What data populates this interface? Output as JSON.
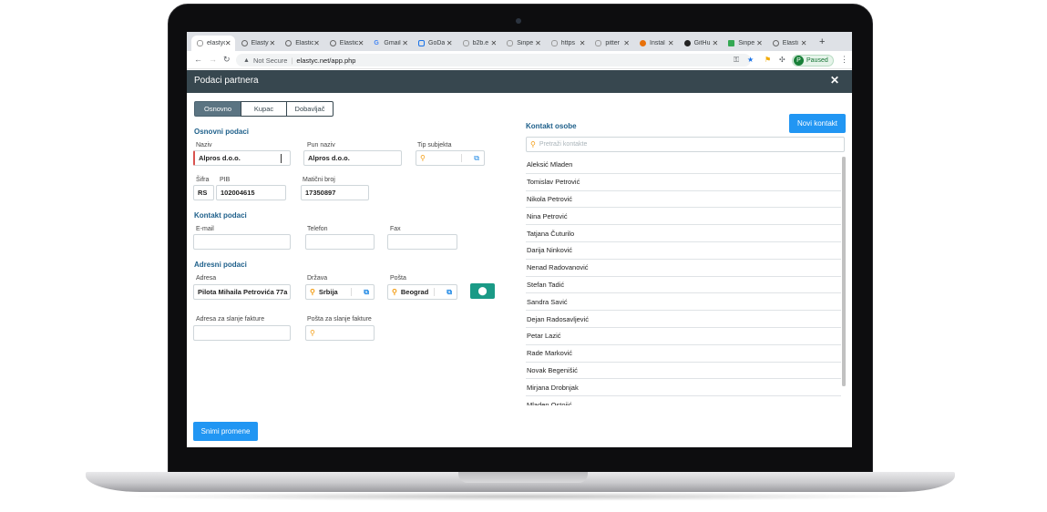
{
  "browser": {
    "tabs": [
      {
        "label": "elastyc",
        "fav": "cloud",
        "active": true
      },
      {
        "label": "Elasty",
        "fav": "globe"
      },
      {
        "label": "Elastic",
        "fav": "globe"
      },
      {
        "label": "Elastic",
        "fav": "globe"
      },
      {
        "label": "Gmail",
        "fav": "g"
      },
      {
        "label": "GoDa",
        "fav": "shield"
      },
      {
        "label": "b2b.e",
        "fav": "cloud"
      },
      {
        "label": "Sinpe",
        "fav": "cloud"
      },
      {
        "label": "https",
        "fav": "cloud"
      },
      {
        "label": "pitter",
        "fav": "cloud"
      },
      {
        "label": "Instal",
        "fav": "fire"
      },
      {
        "label": "GitHu",
        "fav": "gh"
      },
      {
        "label": "Sinpe",
        "fav": "green"
      },
      {
        "label": "Elasti",
        "fav": "globe"
      }
    ],
    "tab_close": "✕",
    "new_tab": "+",
    "security_label": "Not Secure",
    "url": "elastyc.net/app.php",
    "profile_initial": "P",
    "profile_status": "Paused"
  },
  "app": {
    "title": "Podaci partnera",
    "close_icon": "✕",
    "tabs": [
      "Osnovno",
      "Kupac",
      "Dobavljač"
    ],
    "sections": {
      "basic": "Osnovni podaci",
      "contact": "Kontakt podaci",
      "address": "Adresni podaci"
    },
    "fields": {
      "naziv": {
        "label": "Naziv",
        "value": "Alpros d.o.o."
      },
      "pun_naziv": {
        "label": "Pun naziv",
        "value": "Alpros d.o.o."
      },
      "tip_subjekta": {
        "label": "Tip subjekta",
        "value": ""
      },
      "sifra": {
        "label": "Šifra",
        "value": "RS"
      },
      "pib": {
        "label": "PIB",
        "value": "102004615"
      },
      "maticni_broj": {
        "label": "Matični broj",
        "value": "17350897"
      },
      "email": {
        "label": "E-mail",
        "value": ""
      },
      "telefon": {
        "label": "Telefon",
        "value": ""
      },
      "fax": {
        "label": "Fax",
        "value": ""
      },
      "adresa": {
        "label": "Adresa",
        "value": "Pilota Mihaila Petrovića 77a"
      },
      "drzava": {
        "label": "Država",
        "value": "Srbija"
      },
      "posta": {
        "label": "Pošta",
        "value": "Beograd"
      },
      "adresa_fakture": {
        "label": "Adresa za slanje fakture",
        "value": ""
      },
      "posta_fakture": {
        "label": "Pošta za slanje fakture",
        "value": ""
      }
    },
    "save_button": "Snimi promene",
    "contacts": {
      "title": "Kontakt osobe",
      "new_button": "Novi kontakt",
      "search_placeholder": "Pretraži kontakte",
      "items": [
        "Aleksić Mladen",
        "Tomislav Petrović",
        "Nikola Petrović",
        "Nina Petrović",
        "Tatjana Čuturilo",
        "Darija Ninković",
        "Nenad Radovanović",
        "Stefan Tadić",
        "Sandra Savić",
        "Dejan Radosavljević",
        "Petar Lazić",
        "Rade Marković",
        "Novak Begenišić",
        "Mirjana Drobnjak",
        "Mladen Ostojić"
      ]
    }
  }
}
